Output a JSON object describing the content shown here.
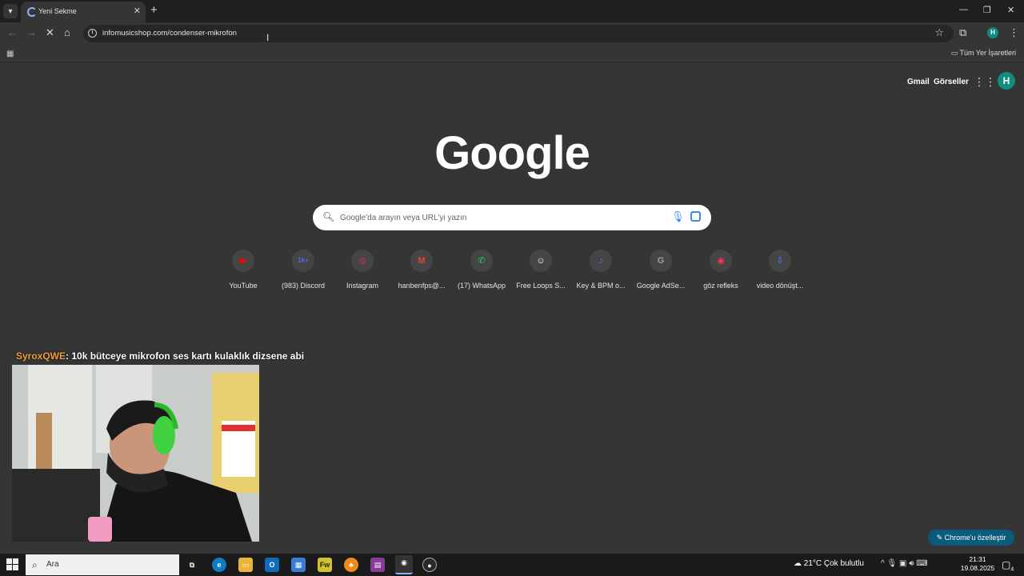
{
  "browser": {
    "tab_title": "Yeni Sekme",
    "url": "infomusicshop.com/condenser-mikrofon",
    "bookmarks_label": "Tüm Yer İşaretleri"
  },
  "header": {
    "gmail": "Gmail",
    "images": "Görseller",
    "avatar_letter": "H"
  },
  "logo": "Google",
  "search": {
    "placeholder": "Google'da arayın veya URL'yi yazın"
  },
  "shortcuts": [
    {
      "label": "YouTube",
      "icon": "youtube-icon",
      "glyph": "▶",
      "color": "#ff0000"
    },
    {
      "label": "(983) Discord",
      "icon": "discord-icon",
      "glyph": "1k+",
      "color": "#5865f2"
    },
    {
      "label": "Instagram",
      "icon": "instagram-icon",
      "glyph": "◎",
      "color": "#e1306c"
    },
    {
      "label": "hanbenfps@...",
      "icon": "gmail-icon",
      "glyph": "M",
      "color": "#ea4335"
    },
    {
      "label": "(17) WhatsApp",
      "icon": "whatsapp-icon",
      "glyph": "✆",
      "color": "#25d366"
    },
    {
      "label": "Free Loops S...",
      "icon": "freeloops-icon",
      "glyph": "☺",
      "color": "#ffffff"
    },
    {
      "label": "Key & BPM o...",
      "icon": "key-bpm-icon",
      "glyph": "♪",
      "color": "#6b6bff"
    },
    {
      "label": "Google AdSe...",
      "icon": "adsense-icon",
      "glyph": "G",
      "color": "#9aa0a6"
    },
    {
      "label": "göz refleks",
      "icon": "goz-refleks-icon",
      "glyph": "◉",
      "color": "#ff3355"
    },
    {
      "label": "video dönüşt...",
      "icon": "video-convert-icon",
      "glyph": "⇩",
      "color": "#4a6cff"
    }
  ],
  "stream_overlay": {
    "chat_user": "SyroxQWE",
    "chat_message": ": 10k bütceye mikrofon ses kartı kulaklık dizsene abi"
  },
  "customize_button": "Chrome'u özelleştir",
  "taskbar": {
    "search_text": "Ara",
    "weather": "21°C  Çok bulutlu",
    "time": "21:31",
    "date": "19.08.2025",
    "notification_count": "4"
  }
}
